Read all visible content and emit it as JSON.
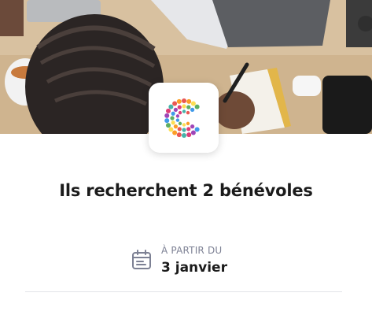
{
  "hero": {
    "image": "workspace-photo"
  },
  "logo": {
    "icon": "dotted-circle-logo-icon",
    "colors": [
      "#e53935",
      "#fb8c00",
      "#fdd835",
      "#43a047",
      "#1e88e5",
      "#8e24aa",
      "#d81b60",
      "#26a69a"
    ]
  },
  "headline": "Ils recherchent 2 bénévoles",
  "date": {
    "icon": "calendar-icon",
    "caption": "À PARTIR DU",
    "value": "3 janvier"
  }
}
